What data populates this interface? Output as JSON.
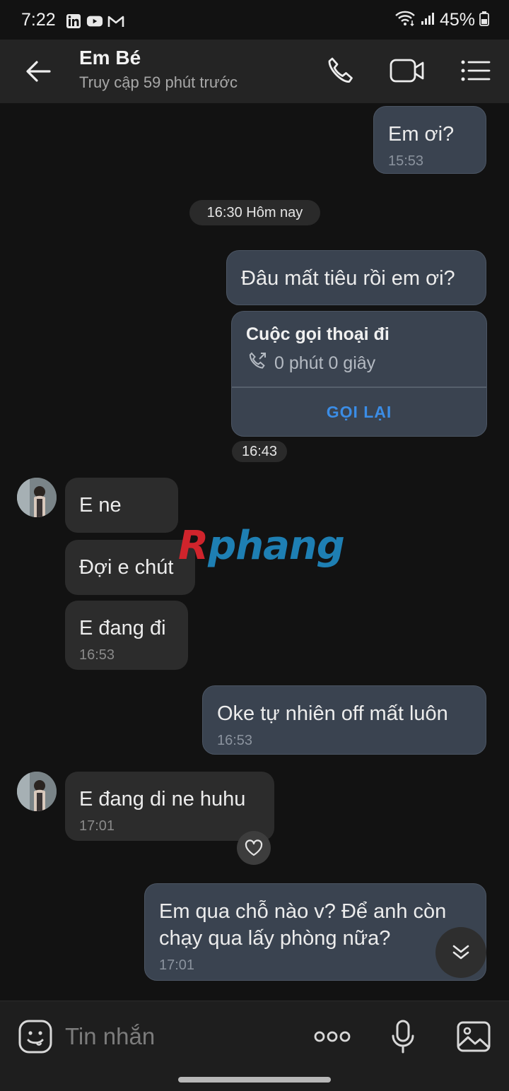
{
  "status_bar": {
    "time": "7:22",
    "apps": [
      "linkedin-icon",
      "youtube-icon",
      "gmail-icon"
    ],
    "battery": "45%"
  },
  "header": {
    "contact_name": "Em Bé",
    "last_seen": "Truy cập 59 phút trước",
    "icons": [
      "back-arrow-icon",
      "phone-icon",
      "video-call-icon",
      "menu-list-icon"
    ]
  },
  "messages": {
    "m1": {
      "text": "Em ơi?",
      "time": "15:53"
    },
    "date_chip": "16:30 Hôm nay",
    "m2": {
      "text": "Đâu mất tiêu rồi em ơi?"
    },
    "call": {
      "title": "Cuộc gọi thoại đi",
      "duration": "0 phút 0 giây",
      "callback": "GỌI LẠI",
      "time": "16:43"
    },
    "m3": {
      "text": "E ne"
    },
    "m4": {
      "text": "Đợi e chút"
    },
    "m5": {
      "text": "E đang đi",
      "time": "16:53"
    },
    "m6": {
      "text": "Oke tự nhiên off mất luôn",
      "time": "16:53"
    },
    "m7": {
      "text": "E đang di ne huhu",
      "time": "17:01"
    },
    "m8": {
      "line1": "Em qua chỗ nào v? Để anh còn",
      "line2": "chạy qua lấy phòng nữa?",
      "time": "17:01"
    }
  },
  "watermark": {
    "first": "R",
    "rest": "phang"
  },
  "input_bar": {
    "placeholder": "Tin nhắn",
    "icons": [
      "sticker-icon",
      "more-options-icon",
      "microphone-icon",
      "gallery-icon"
    ]
  },
  "colors": {
    "background": "#121212",
    "outgoing_bubble": "#3a4350",
    "incoming_bubble": "#2c2c2c",
    "accent": "#3b8de6"
  }
}
